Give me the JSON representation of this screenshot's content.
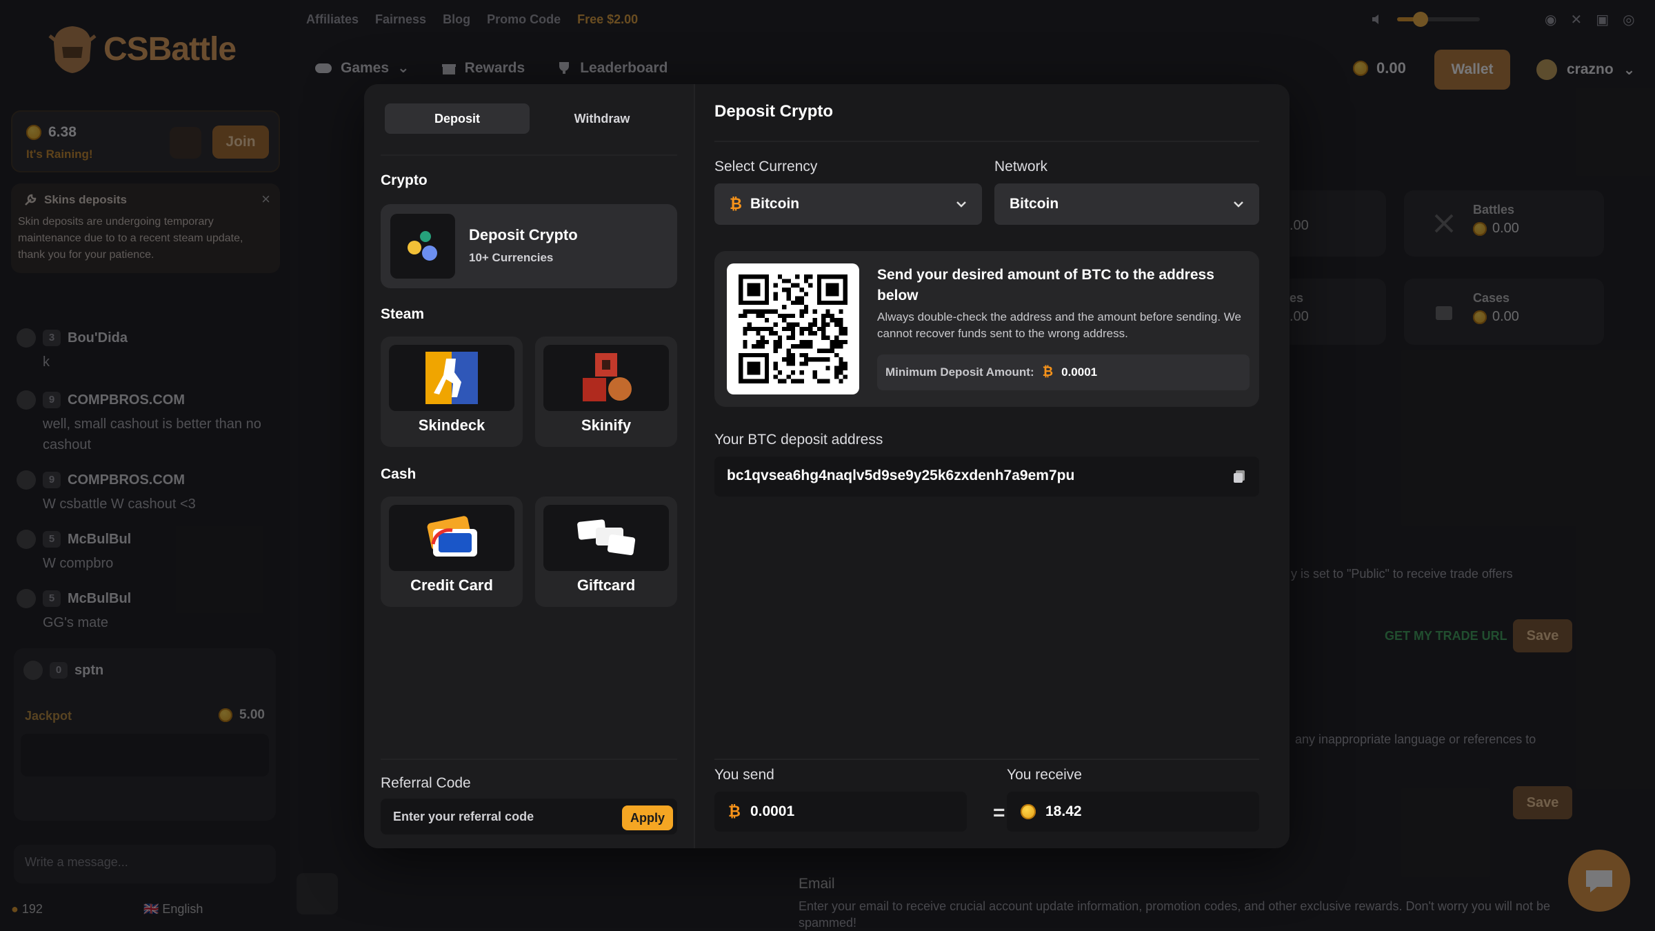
{
  "site": {
    "logo_text": "CSBattle",
    "top_links": [
      "Affiliates",
      "Fairness",
      "Blog",
      "Promo Code",
      "Free $2.00"
    ],
    "main_nav": [
      "Games",
      "Rewards",
      "Leaderboard"
    ],
    "balance": "0.00",
    "wallet_label": "Wallet",
    "username": "crazno",
    "volume_level": 0.28
  },
  "sidebar": {
    "rain_amount": "6.38",
    "rain_sub": "It's Raining!",
    "join_label": "Join",
    "notice_title": "Skins deposits",
    "notice_body": "Skin deposits are undergoing temporary maintenance due to to a recent steam update, thank you for your patience.",
    "messages": [
      {
        "level": "3",
        "user": "Bou'Dida",
        "text": "k"
      },
      {
        "level": "9",
        "user": "COMPBROS.COM",
        "text": "well, small cashout is better than no cashout"
      },
      {
        "level": "9",
        "user": "COMPBROS.COM",
        "text": "W csbattle W cashout <3"
      },
      {
        "level": "5",
        "user": "McBulBul",
        "text": "W compbro"
      },
      {
        "level": "5",
        "user": "McBulBul",
        "text": "GG's mate"
      }
    ],
    "jackpot_user_level": "0",
    "jackpot_user": "sptn",
    "jackpot_label": "Jackpot",
    "jackpot_value": "5.00",
    "write_placeholder": "Write a message...",
    "online_count": "192",
    "language": "English"
  },
  "background": {
    "stats": [
      {
        "label": "Battles",
        "value": "0.00"
      },
      {
        "label": "Cases",
        "value": "0.00"
      }
    ],
    "partial_values": [
      ".00",
      ".00"
    ],
    "partial_es": "es",
    "trade_note": "y is set to \"Public\" to receive trade offers",
    "get_trade_url": "GET MY TRADE URL",
    "save_label": "Save",
    "language_note": "any inappropriate language or references to",
    "email_title": "Email",
    "email_desc": "Enter your email to receive crucial account update information, promotion codes, and other exclusive rewards. Don't worry you will not be spammed!"
  },
  "modal": {
    "tabs": [
      "Deposit",
      "Withdraw"
    ],
    "sections": {
      "crypto": "Crypto",
      "steam": "Steam",
      "cash": "Cash"
    },
    "crypto_method": {
      "name": "Deposit Crypto",
      "sub": "10+ Currencies"
    },
    "steam_methods": [
      "Skindeck",
      "Skinify"
    ],
    "cash_methods": [
      "Credit Card",
      "Giftcard"
    ],
    "referral_label": "Referral Code",
    "referral_placeholder": "Enter your referral code",
    "apply_label": "Apply",
    "title": "Deposit Crypto",
    "currency_label": "Select Currency",
    "currency_value": "Bitcoin",
    "network_label": "Network",
    "network_value": "Bitcoin",
    "qr_title": "Send your desired amount of BTC to the address below",
    "qr_note": "Always double-check the address and the amount before sending. We cannot recover funds sent to the wrong address.",
    "min_label": "Minimum Deposit Amount:",
    "min_value": "0.0001",
    "address_label": "Your BTC deposit address",
    "address": "bc1qvsea6hg4naqlv5d9se9y25k6zxdenh7a9em7pu",
    "send_label": "You send",
    "send_value": "0.0001",
    "equals": "=",
    "receive_label": "You receive",
    "receive_value": "18.42"
  },
  "colors": {
    "accent": "#f5a623",
    "btc": "#f7931a",
    "modal_bg": "#19191b"
  }
}
